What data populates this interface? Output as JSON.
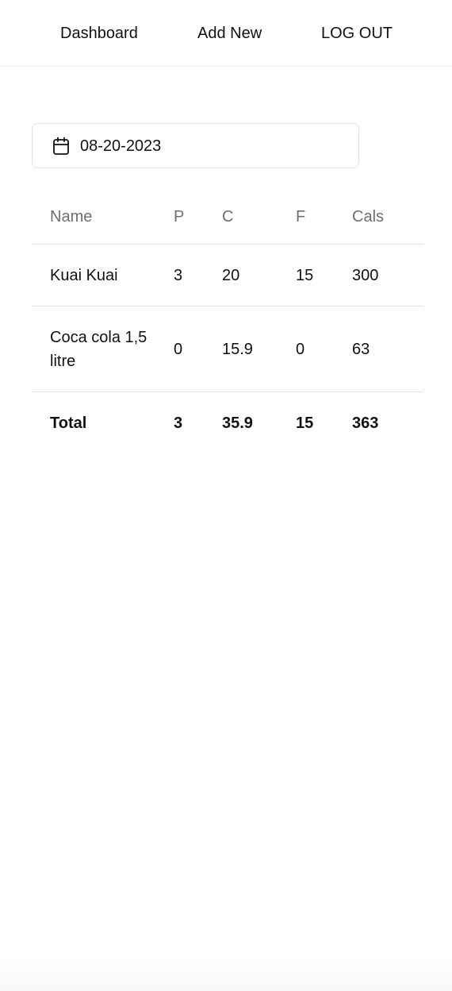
{
  "nav": {
    "dashboard": "Dashboard",
    "add_new": "Add New",
    "log_out": "LOG OUT"
  },
  "date_picker": {
    "icon": "calendar-icon",
    "value": "08-20-2023"
  },
  "table": {
    "headers": {
      "name": "Name",
      "p": "P",
      "c": "C",
      "f": "F",
      "cals": "Cals"
    },
    "rows": [
      {
        "name": "Kuai Kuai",
        "p": "3",
        "c": "20",
        "f": "15",
        "cals": "300"
      },
      {
        "name": "Coca cola 1,5 litre",
        "p": "0",
        "c": "15.9",
        "f": "0",
        "cals": "63"
      }
    ],
    "total": {
      "label": "Total",
      "p": "3",
      "c": "35.9",
      "f": "15",
      "cals": "363"
    }
  },
  "colors": {
    "text": "#111111",
    "header_text": "#6f6f6f",
    "border": "#e2e2e2",
    "background": "#ffffff"
  }
}
